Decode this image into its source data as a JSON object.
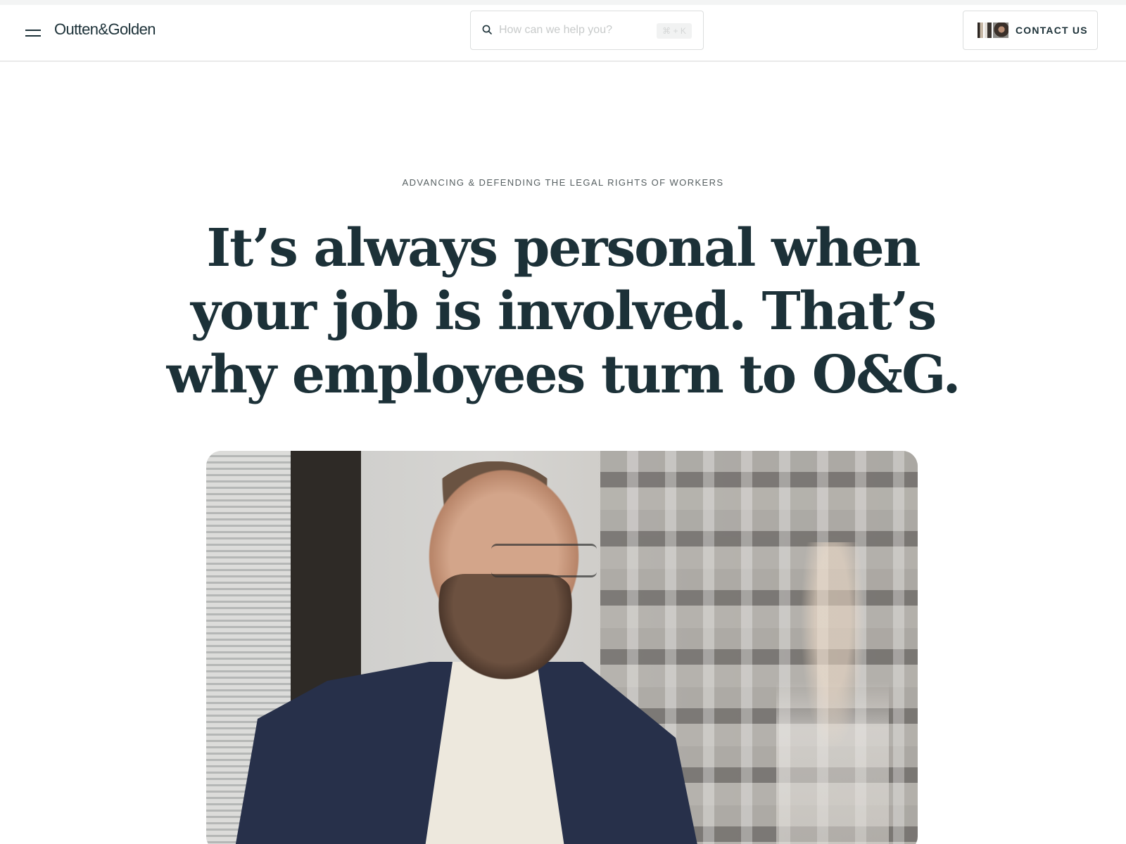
{
  "header": {
    "logo": "Outten&Golden",
    "search_placeholder": "How can we help you?",
    "search_shortcut": "⌘ + K",
    "contact_label": "CONTACT US"
  },
  "hero": {
    "eyebrow": "ADVANCING & DEFENDING THE LEGAL RIGHTS OF WORKERS",
    "headline": "It’s always personal when your job is involved. That’s why employees turn to O&G."
  },
  "icons": {
    "menu": "menu-icon",
    "search": "search-icon"
  },
  "colors": {
    "brand_text": "#1c3138",
    "border": "#dcdede"
  }
}
